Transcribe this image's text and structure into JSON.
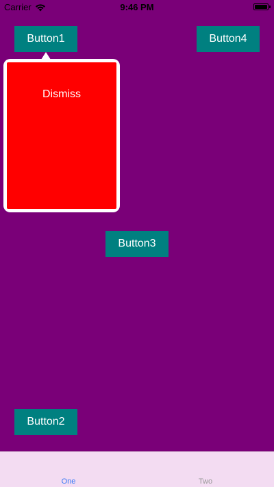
{
  "status_bar": {
    "carrier": "Carrier",
    "time": "9:46 PM"
  },
  "buttons": {
    "button1": "Button1",
    "button2": "Button2",
    "button3": "Button3",
    "button4": "Button4"
  },
  "popover": {
    "dismiss_label": "Dismiss"
  },
  "tab_bar": {
    "tabs": [
      {
        "label": "One",
        "selected": true
      },
      {
        "label": "Two",
        "selected": false
      }
    ]
  },
  "colors": {
    "background": "#7a0078",
    "button": "#008080",
    "popover_content": "#ff0000",
    "tab_bar": "#f3dcf2",
    "tab_selected": "#3478f6",
    "tab_unselected": "#999999"
  }
}
